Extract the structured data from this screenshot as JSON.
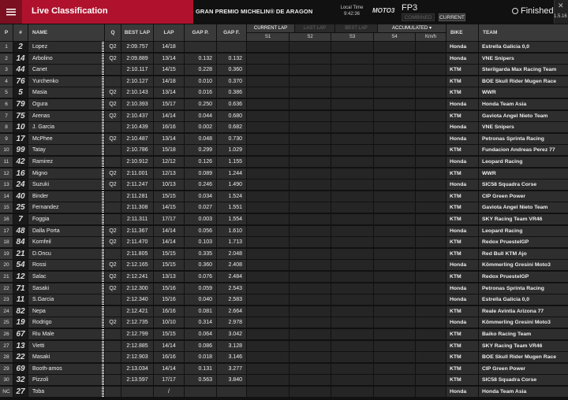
{
  "header": {
    "title": "Live Classification",
    "event": "GRAN PREMIO MICHELIN® DE ARAGON",
    "local_time_label": "Local Time",
    "local_time": "9:42:36",
    "series_logo": "MOTO3",
    "session": "FP3",
    "combined_label": "COMBINED",
    "current_label": "CURRENT",
    "status": "Finished",
    "version": "1.5.16",
    "menu_icon": "hamburger-icon",
    "close_icon": "close-icon"
  },
  "columns": {
    "pos": "P",
    "num": "#",
    "name": "NAME",
    "q": "Q",
    "best_lap": "BEST LAP",
    "lap": "LAP",
    "gap_p": "GAP P.",
    "gap_f": "GAP F.",
    "s1": "S1",
    "s2": "S2",
    "s3": "S3",
    "s4": "S4",
    "speed": "Km/h",
    "bike": "BIKE",
    "team": "TEAM",
    "tab_current_lap": "CURRENT LAP",
    "tab_last_lap": "LAST LAP",
    "tab_best_lap": "BEST LAP",
    "tab_accumulated": "ACCUMULATED"
  },
  "rows": [
    {
      "pos": "1",
      "num": "2",
      "name": "Lopez",
      "pit": "",
      "q": "Q2",
      "best": "2:09.757",
      "lap": "14/18",
      "gp": "",
      "gf": "",
      "bike": "Honda",
      "team": "Estrella Galicia 0,0"
    },
    {
      "pos": "2",
      "num": "14",
      "name": "Arbolino",
      "pit": "",
      "q": "Q2",
      "best": "2:09.889",
      "lap": "13/14",
      "gp": "0.132",
      "gf": "0.132",
      "bike": "Honda",
      "team": "VNE Snipers"
    },
    {
      "pos": "3",
      "num": "44",
      "name": "Canet",
      "pit": "P",
      "q": "",
      "best": "2:10.117",
      "lap": "14/15",
      "gp": "0.228",
      "gf": "0.360",
      "bike": "KTM",
      "team": "Sterilgarda Max Racing Team"
    },
    {
      "pos": "4",
      "num": "76",
      "name": "Yurchenko",
      "pit": "",
      "q": "",
      "best": "2:10.127",
      "lap": "14/18",
      "gp": "0.010",
      "gf": "0.370",
      "bike": "KTM",
      "team": "BOE Skull Rider Mugen Race"
    },
    {
      "pos": "5",
      "num": "5",
      "name": "Masia",
      "pit": "",
      "q": "Q2",
      "best": "2:10.143",
      "lap": "13/14",
      "gp": "0.016",
      "gf": "0.386",
      "bike": "KTM",
      "team": "WWR"
    },
    {
      "pos": "6",
      "num": "79",
      "name": "Ogura",
      "pit": "",
      "q": "Q2",
      "best": "2:10.393",
      "lap": "15/17",
      "gp": "0.250",
      "gf": "0.636",
      "bike": "Honda",
      "team": "Honda Team Asia"
    },
    {
      "pos": "7",
      "num": "75",
      "name": "Arenas",
      "pit": "",
      "q": "Q2",
      "best": "2:10.437",
      "lap": "14/14",
      "gp": "0.044",
      "gf": "0.680",
      "bike": "KTM",
      "team": "Gaviota Angel Nieto Team"
    },
    {
      "pos": "8",
      "num": "10",
      "name": "J. Garcia",
      "pit": "",
      "q": "",
      "best": "2:10.439",
      "lap": "16/16",
      "gp": "0.002",
      "gf": "0.682",
      "bike": "Honda",
      "team": "VNE Snipers"
    },
    {
      "pos": "9",
      "num": "17",
      "name": "McPhee",
      "pit": "P",
      "q": "Q2",
      "best": "2:10.487",
      "lap": "13/14",
      "gp": "0.048",
      "gf": "0.730",
      "bike": "Honda",
      "team": "Petronas Sprinta Racing"
    },
    {
      "pos": "10",
      "num": "99",
      "name": "Tatay",
      "pit": "P",
      "q": "",
      "best": "2:10.786",
      "lap": "15/18",
      "gp": "0.299",
      "gf": "1.029",
      "bike": "KTM",
      "team": "Fundacion Andreas Perez 77"
    },
    {
      "pos": "11",
      "num": "42",
      "name": "Ramirez",
      "pit": "",
      "q": "",
      "best": "2:10.912",
      "lap": "12/12",
      "gp": "0.126",
      "gf": "1.155",
      "bike": "Honda",
      "team": "Leopard Racing"
    },
    {
      "pos": "12",
      "num": "16",
      "name": "Migno",
      "pit": "P",
      "q": "Q2",
      "best": "2:11.001",
      "lap": "12/13",
      "gp": "0.089",
      "gf": "1.244",
      "bike": "KTM",
      "team": "WWR"
    },
    {
      "pos": "13",
      "num": "24",
      "name": "Suzuki",
      "pit": "",
      "q": "Q2",
      "best": "2:11.247",
      "lap": "10/13",
      "gp": "0.246",
      "gf": "1.490",
      "bike": "Honda",
      "team": "SIC58 Squadra Corse"
    },
    {
      "pos": "14",
      "num": "40",
      "name": "Binder",
      "pit": "",
      "q": "",
      "best": "2:11.281",
      "lap": "15/15",
      "gp": "0.034",
      "gf": "1.524",
      "bike": "KTM",
      "team": "CIP Green Power"
    },
    {
      "pos": "15",
      "num": "25",
      "name": "Fernandez",
      "pit": "P",
      "q": "",
      "best": "2:11.308",
      "lap": "14/15",
      "gp": "0.027",
      "gf": "1.551",
      "bike": "KTM",
      "team": "Gaviota Angel Nieto Team"
    },
    {
      "pos": "16",
      "num": "7",
      "name": "Foggia",
      "pit": "",
      "q": "",
      "best": "2:11.311",
      "lap": "17/17",
      "gp": "0.003",
      "gf": "1.554",
      "bike": "KTM",
      "team": "SKY Racing Team VR46"
    },
    {
      "pos": "17",
      "num": "48",
      "name": "Dalla Porta",
      "pit": "",
      "q": "Q2",
      "best": "2:11.367",
      "lap": "14/14",
      "gp": "0.056",
      "gf": "1.610",
      "bike": "Honda",
      "team": "Leopard Racing"
    },
    {
      "pos": "18",
      "num": "84",
      "name": "Kornfeil",
      "pit": "",
      "q": "Q2",
      "best": "2:11.470",
      "lap": "14/14",
      "gp": "0.103",
      "gf": "1.713",
      "bike": "KTM",
      "team": "Redox PruestelGP"
    },
    {
      "pos": "19",
      "num": "21",
      "name": "D.Oncu",
      "pit": "",
      "q": "",
      "best": "2:11.805",
      "lap": "15/15",
      "gp": "0.335",
      "gf": "2.048",
      "bike": "KTM",
      "team": "Red Bull KTM Ajo"
    },
    {
      "pos": "20",
      "num": "54",
      "name": "Rossi",
      "pit": "",
      "q": "Q2",
      "best": "2:12.165",
      "lap": "15/15",
      "gp": "0.360",
      "gf": "2.408",
      "bike": "Honda",
      "team": "Kömmerling Gresini Moto3"
    },
    {
      "pos": "21",
      "num": "12",
      "name": "Salac",
      "pit": "",
      "q": "Q2",
      "best": "2:12.241",
      "lap": "13/13",
      "gp": "0.076",
      "gf": "2.484",
      "bike": "KTM",
      "team": "Redox PruestelGP"
    },
    {
      "pos": "22",
      "num": "71",
      "name": "Sasaki",
      "pit": "P",
      "q": "Q2",
      "best": "2:12.300",
      "lap": "15/16",
      "gp": "0.059",
      "gf": "2.543",
      "bike": "Honda",
      "team": "Petronas Sprinta Racing"
    },
    {
      "pos": "23",
      "num": "11",
      "name": "S.Garcia",
      "pit": "",
      "q": "",
      "best": "2:12.340",
      "lap": "15/16",
      "gp": "0.040",
      "gf": "2.583",
      "bike": "Honda",
      "team": "Estrella Galicia 0,0"
    },
    {
      "pos": "24",
      "num": "82",
      "name": "Nepa",
      "pit": "",
      "q": "",
      "best": "2:12.421",
      "lap": "16/16",
      "gp": "0.081",
      "gf": "2.664",
      "bike": "KTM",
      "team": "Reale Avintia Arizona 77"
    },
    {
      "pos": "25",
      "num": "19",
      "name": "Rodrigo",
      "pit": "",
      "q": "Q2",
      "best": "2:12.735",
      "lap": "10/10",
      "gp": "0.314",
      "gf": "2.978",
      "bike": "Honda",
      "team": "Kömmerling Gresini Moto3"
    },
    {
      "pos": "26",
      "num": "67",
      "name": "Riu Male",
      "pit": "",
      "q": "",
      "best": "2:12.799",
      "lap": "15/15",
      "gp": "0.064",
      "gf": "3.042",
      "bike": "KTM",
      "team": "Baiko Racing Team"
    },
    {
      "pos": "27",
      "num": "13",
      "name": "Vietti",
      "pit": "",
      "q": "",
      "best": "2:12.885",
      "lap": "14/14",
      "gp": "0.086",
      "gf": "3.128",
      "bike": "KTM",
      "team": "SKY Racing Team VR46"
    },
    {
      "pos": "28",
      "num": "22",
      "name": "Masaki",
      "pit": "",
      "q": "",
      "best": "2:12.903",
      "lap": "16/16",
      "gp": "0.018",
      "gf": "3.146",
      "bike": "KTM",
      "team": "BOE Skull Rider Mugen Race"
    },
    {
      "pos": "29",
      "num": "69",
      "name": "Booth-amos",
      "pit": "",
      "q": "",
      "best": "2:13.034",
      "lap": "14/14",
      "gp": "0.131",
      "gf": "3.277",
      "bike": "KTM",
      "team": "CIP Green Power"
    },
    {
      "pos": "30",
      "num": "32",
      "name": "Pizzoli",
      "pit": "",
      "q": "",
      "best": "2:13.597",
      "lap": "17/17",
      "gp": "0.563",
      "gf": "3.840",
      "bike": "KTM",
      "team": "SIC58 Squadra Corse"
    },
    {
      "pos": "NC",
      "num": "27",
      "name": "Toba",
      "pit": "P",
      "q": "",
      "best": "",
      "lap": "/",
      "gp": "",
      "gf": "",
      "bike": "Honda",
      "team": "Honda Team Asia"
    }
  ]
}
